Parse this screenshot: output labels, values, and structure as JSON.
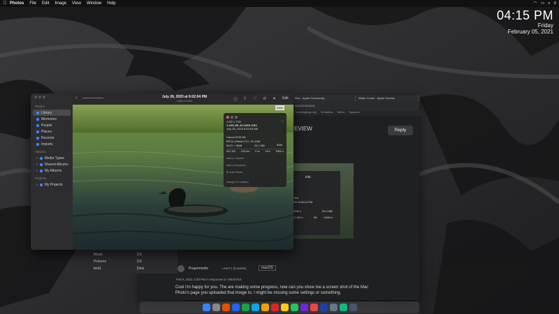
{
  "menubar": {
    "app": "Photos",
    "items": [
      "File",
      "Edit",
      "Image",
      "View",
      "Window",
      "Help"
    ]
  },
  "clock": {
    "time": "04:15 PM",
    "day": "Friday",
    "date": "February 05, 2021"
  },
  "browser": {
    "tabs": [
      "Mac - Apple Community",
      "Water Cooler - Apple Commu"
    ],
    "url": "4663229623481",
    "bookmarks": [
      "Travelinglogo.org",
      "VirtualBox",
      "Metro",
      "Squeeze",
      "Make Discount Ad"
    ],
    "heading": "EVIEW",
    "reply_label": "Reply",
    "author": "Prayermedic",
    "level": "Level 1 (8 points)",
    "tag": "macOS",
    "post_meta": "Feb 5, 2021 3:30 PM in response to ViktorOSX",
    "post_text": "Cool I'm happy for you. The are making some progress, now can you show me a screen shot of the Mac Photo's page you uploaded that image to. I might be missing some settings or something.",
    "finder_items": [
      "Music",
      "Pictures",
      "test1"
    ],
    "finder_files": [
      "DS",
      "DS",
      "Desi"
    ],
    "info2": {
      "title": "Info",
      "line1": "CR3",
      "line2": "020 3:08:10 PM",
      "mp": "29.3 MB",
      "row": [
        "=0.33 m",
        "f/8",
        "1/640 s"
      ],
      "size": "6000 x"
    }
  },
  "photos": {
    "sidebar": {
      "sections": [
        {
          "head": "Photos",
          "items": [
            "Library",
            "Memories",
            "People",
            "Places",
            "Recents",
            "Imports"
          ]
        },
        {
          "head": "Albums",
          "items": [
            "Media Types",
            "Shared Albums",
            "My Albums"
          ]
        },
        {
          "head": "Projects",
          "items": [
            "My Projects"
          ]
        }
      ]
    },
    "title": "July 26, 2020 at 6:02:04 PM",
    "subtitle": "3,600 of 3,600",
    "edit_label": "Edit",
    "badge": "RAW"
  },
  "info": {
    "add_title": "Add a Title",
    "filename": "Y-22D-9K-J0-01ES.CR3",
    "datetime": "July 26, 2020    6:02:04 AM",
    "camera": "Canon EOS R6",
    "lens": "RF24-105mm F4 L IS USM",
    "dims": "5472 × 3648",
    "mp": "24.1 MB",
    "fmt": "RAW",
    "stats": [
      "ISO 400",
      "105 mm",
      "0 ev",
      "f/4.5",
      "1/800 s"
    ],
    "caption": "Add a Caption",
    "keyword": "Add a Keyword",
    "faces": "Add Faces",
    "location": "Assign a Location"
  },
  "colors": {
    "accent": "#3b82f6",
    "window_bg": "#262628",
    "browser_bg": "#1f2022"
  }
}
